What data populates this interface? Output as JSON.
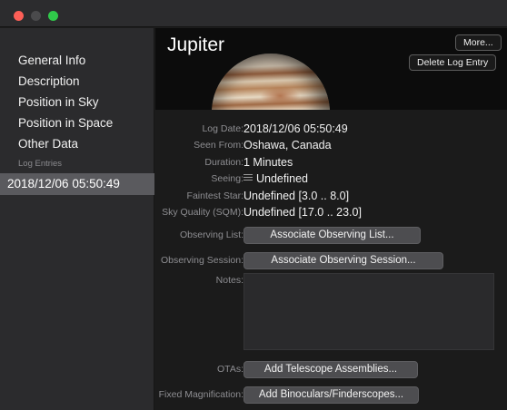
{
  "window": {
    "traffic_lights": {
      "close": "#fd5f57",
      "minimize": "#4a4a4c",
      "zoom": "#30c84a"
    }
  },
  "sidebar": {
    "items": [
      {
        "label": "General Info"
      },
      {
        "label": "Description"
      },
      {
        "label": "Position in Sky"
      },
      {
        "label": "Position in Space"
      },
      {
        "label": "Other Data"
      }
    ],
    "section_label": "Log Entries",
    "log_entries": [
      {
        "label": "2018/12/06 05:50:49",
        "selected": true
      }
    ]
  },
  "header": {
    "title": "Jupiter",
    "more_label": "More...",
    "delete_label": "Delete Log Entry",
    "image": "jupiter-planet-image"
  },
  "details": {
    "log_date": {
      "label": "Log Date:",
      "value": "2018/12/06 05:50:49"
    },
    "seen_from": {
      "label": "Seen From:",
      "value": "Oshawa, Canada"
    },
    "duration": {
      "label": "Duration:",
      "value": "1 Minutes"
    },
    "seeing": {
      "label": "Seeing:",
      "value": "Undefined",
      "icon": "seeing-lines-icon"
    },
    "faintest_star": {
      "label": "Faintest Star:",
      "value": "Undefined [3.0 .. 8.0]"
    },
    "sky_quality": {
      "label": "Sky Quality (SQM):",
      "value": "Undefined [17.0 .. 23.0]"
    },
    "observing_list": {
      "label": "Observing List:",
      "button": "Associate Observing List..."
    },
    "observing_session": {
      "label": "Observing Session:",
      "button": "Associate Observing Session..."
    },
    "notes": {
      "label": "Notes:",
      "value": ""
    },
    "otas": {
      "label": "OTAs:",
      "button": "Add Telescope Assemblies..."
    },
    "fixed_magnification": {
      "label": "Fixed Magnification:",
      "button": "Add Binoculars/Finderscopes..."
    }
  }
}
